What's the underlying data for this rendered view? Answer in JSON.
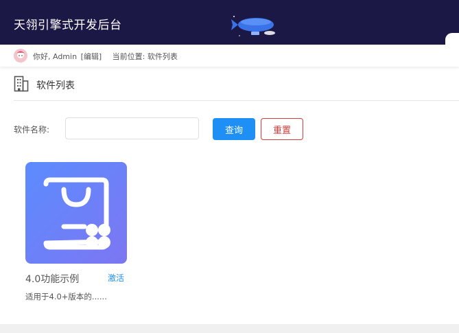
{
  "header": {
    "title": "天翎引擎式开发后台",
    "mascot_icon": "airship-icon",
    "background": "#1b1845"
  },
  "userbar": {
    "greeting": "你好, Admin",
    "edit_link": "[编辑]",
    "location": "当前位置: 软件列表",
    "avatar_icon": "avatar-icon"
  },
  "section": {
    "icon": "building-icon",
    "title": "软件列表"
  },
  "search": {
    "label": "软件名称:",
    "value": "",
    "placeholder": "",
    "query_button": "查询",
    "reset_button": "重置"
  },
  "apps": [
    {
      "name": "4.0功能示例",
      "action": "激活",
      "description": "适用于4.0+版本的......",
      "icon": "shopping-bag-grid-icon"
    }
  ],
  "colors": {
    "accent": "#1e90f5",
    "danger": "#d43b3b",
    "card_gradient_start": "#5b8cff",
    "card_gradient_end": "#7d76f2"
  }
}
